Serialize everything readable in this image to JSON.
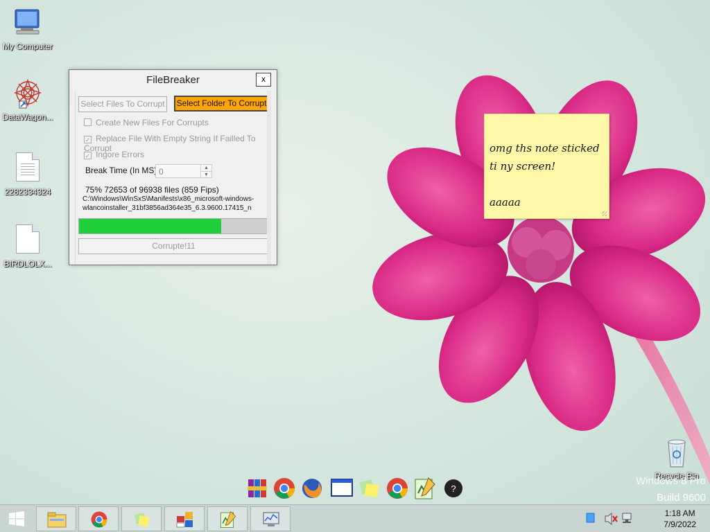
{
  "desktop": {
    "icons": [
      {
        "label": "My Computer"
      },
      {
        "label": "DataWagon..."
      },
      {
        "label": "2282334324"
      },
      {
        "label": "BIRDLOLX..."
      }
    ],
    "recycle_bin": {
      "label": "Recycle Bin"
    },
    "watermark": {
      "edition": "Windows 8 Pro",
      "build": "Build 9600"
    }
  },
  "filebreaker": {
    "title": "FileBreaker",
    "close_label": "x",
    "select_files_label": "Select Files To Corrupt",
    "select_folder_label": "Select Folder To Corrupt",
    "options": [
      {
        "label": "Create New Files For Corrupts",
        "checked": false
      },
      {
        "label": "Replace File With Empty String If Failled To Corrupt",
        "checked": true
      },
      {
        "label": "Ingore Errors",
        "checked": true
      }
    ],
    "break_time_label": "Break Time (In MS)",
    "break_time_value": "0",
    "status_line": "75% 72653 of 96938 files (859 Fips)",
    "path_line1": "C:\\Windows\\WinSxS\\Manifests\\x86_microsoft-windows-",
    "path_line2": "wlancoinstaller_31bf3856ad364e35_6.3.9600.17415_n",
    "progress_percent": 75,
    "corrupt_button_label": "Corrupte!11",
    "progress_color": "#1fcf3a",
    "accent_color": "#ffa500"
  },
  "sticky_note": {
    "lines": [
      "omg ths note sticked",
      "ti ny screen!",
      "",
      "aaaaa"
    ],
    "color": "#fdf8a8"
  },
  "dock": {
    "icons": [
      "winrar-icon",
      "chrome-icon",
      "firefox-icon",
      "window-icon",
      "sticky-notes-icon",
      "chrome-icon",
      "notepad-plus-icon",
      "help-icon"
    ]
  },
  "taskbar": {
    "buttons": [
      "file-explorer-icon",
      "chrome-icon",
      "sticky-notes-icon",
      "control-panel-icon",
      "notepad-plus-icon",
      "resource-monitor-icon"
    ],
    "clock": {
      "time": "1:18 AM",
      "date": "7/9/2022"
    }
  }
}
